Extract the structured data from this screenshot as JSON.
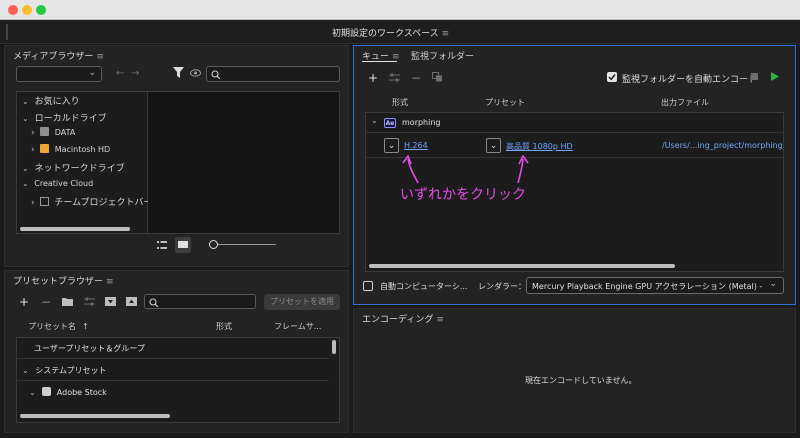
{
  "window": {
    "title": "初期設定のワークスペース"
  },
  "media_browser": {
    "title": "メディアブラウザー",
    "tree": [
      {
        "label": "お気に入り"
      },
      {
        "label": "ローカルドライブ"
      },
      {
        "label": "DATA"
      },
      {
        "label": "Macintosh HD"
      },
      {
        "label": "ネットワークドライブ"
      },
      {
        "label": "Creative Cloud"
      },
      {
        "label": "チームプロジェクトバージョ"
      }
    ]
  },
  "queue": {
    "tab_queue": "キュー",
    "tab_watch": "監視フォルダー",
    "auto_encode_label": "監視フォルダーを自動エンコード",
    "columns": {
      "format": "形式",
      "preset": "プリセット",
      "output": "出力ファイル"
    },
    "item": {
      "badge": "Ae",
      "name": "morphing",
      "format": "H.264",
      "preset": "高品質 1080p HD",
      "output": "/Users/...ing_project/morphing_AME/"
    },
    "annotation": "いずれかをクリック",
    "auto_computer_label": "自動コンピューターシ...",
    "renderer_label": "レンダラー：",
    "renderer_value": "Mercury Playback Engine GPU アクセラレーション (Metal) - 推奨"
  },
  "preset_browser": {
    "title": "プリセットブラウザー",
    "apply_button": "プリセットを適用",
    "columns": {
      "name": "プリセット名",
      "format": "形式",
      "frame": "フレームサ..."
    },
    "rows": [
      {
        "label": "ユーザープリセット＆グループ"
      },
      {
        "label": "システムプリセット"
      },
      {
        "label": "Adobe Stock"
      }
    ]
  },
  "encoding": {
    "title": "エンコーディング",
    "status": "現在エンコードしていません。"
  },
  "colors": {
    "accent_blue": "#2f6fd6",
    "link": "#6fa8ff",
    "annotation": "#e64be8",
    "play_green": "#2fb344"
  }
}
